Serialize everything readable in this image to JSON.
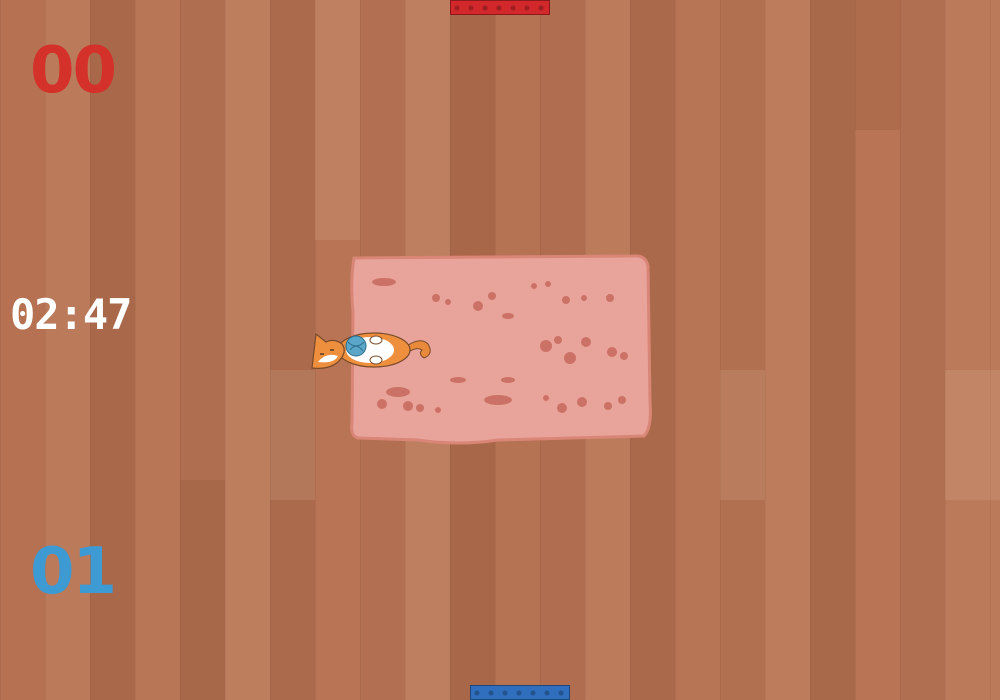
{
  "scoreboard": {
    "red_score": "00",
    "blue_score": "01",
    "red_color": "#d4312a",
    "blue_color": "#3e9ad3"
  },
  "timer": {
    "value": "02:47"
  },
  "goals": {
    "top_color": "#d2282c",
    "bottom_color": "#2f6fbe"
  },
  "playfield": {
    "rug_color": "#e8a49a",
    "player_sprite": "orange-cat-with-yarn-ball",
    "floor": "wood-planks"
  }
}
